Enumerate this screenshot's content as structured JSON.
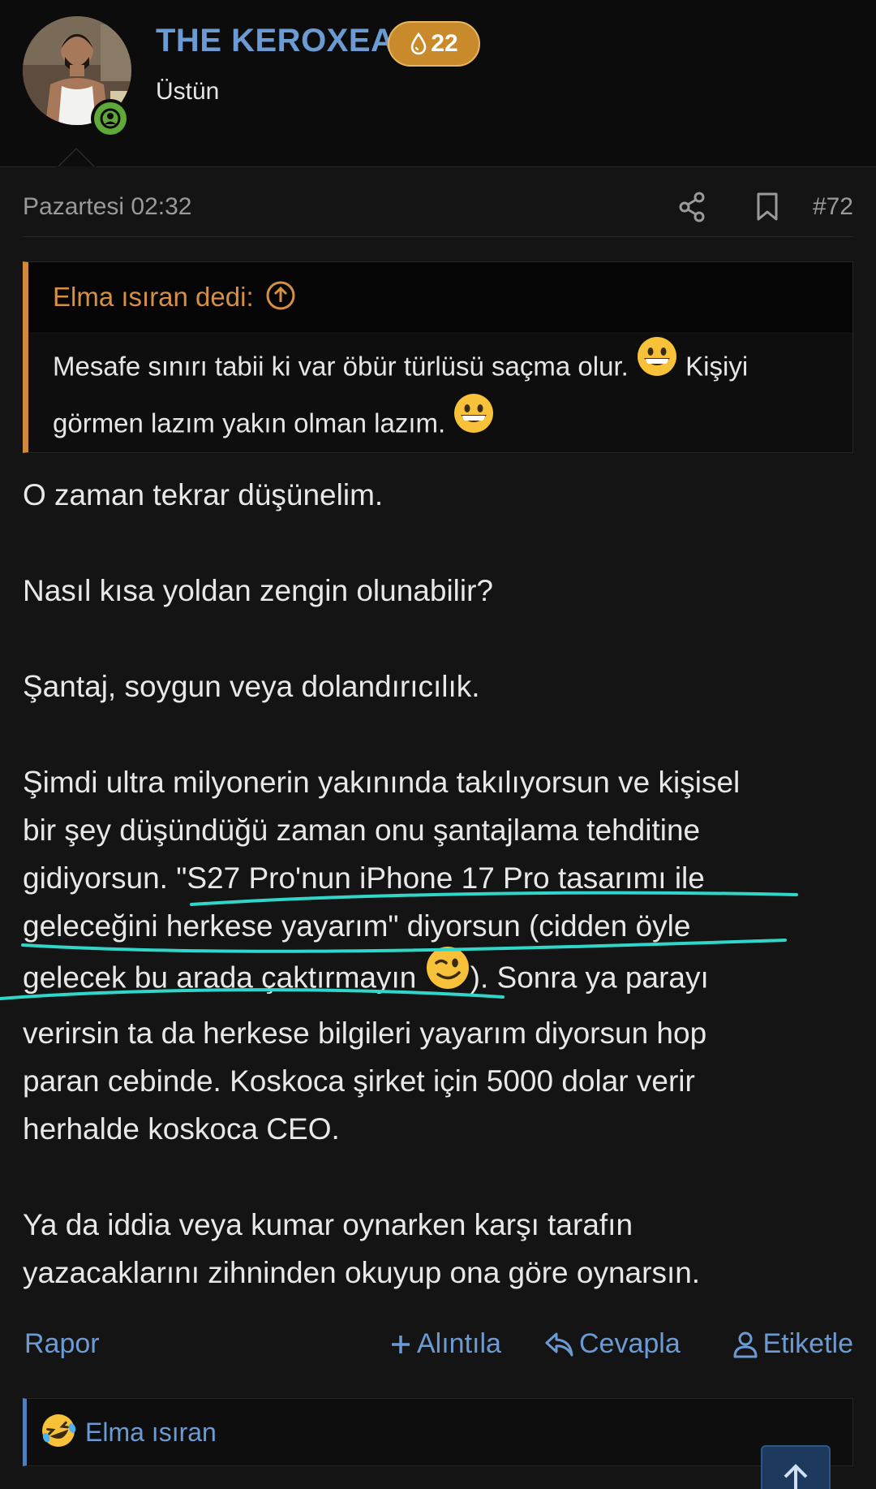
{
  "user": {
    "name": "THE KEROXEA",
    "reaction_score": "22",
    "title": "Üstün",
    "status": "online"
  },
  "post": {
    "date": "Pazartesi 02:32",
    "number": "#72"
  },
  "quote": {
    "author": "Elma ısıran dedi:",
    "text_1": "Mesafe sınırı tabii ki var öbür türlüsü saçma olur.",
    "text_2": "Kişiyi",
    "text_3": "görmen lazım yakın olman lazım.",
    "emoji": "grinning-face"
  },
  "body": {
    "p1": "O zaman tekrar düşünelim.",
    "p2": "Nasıl kısa yoldan zengin olunabilir?",
    "p3": "Şantaj, soygun veya dolandırıcılık.",
    "p4_line1": "Şimdi ultra milyonerin yakınında takılıyorsun ve kişisel",
    "p4_line2": "bir şey düşündüğü zaman onu şantajlama tehditine",
    "p4_line3a": "gidiyorsun. ",
    "p4_line3b": "\"S27 Pro'nun iPhone 17 Pro tasarımı ile",
    "p4_line4a": "geleceğini herkese yayarım\"",
    "p4_line4b": " diyorsun (cidden öyle",
    "p4_line5a": "gelecek bu arada çaktırmayın ",
    "p4_line5b": "). Sonra ya parayı",
    "p4_line6": "verirsin ta da herkese bilgileri yayarım diyorsun hop",
    "p4_line7": "paran cebinde. Koskoca şirket için 5000 dolar verir",
    "p4_line8": "herhalde koskoca CEO.",
    "p5_line1": "Ya da iddia veya kumar oynarken karşı tarafın",
    "p5_line2": "yazacaklarını zihninden okuyup ona göre oynarsın.",
    "wink_emoji": "winking-face"
  },
  "actions": {
    "report": "Rapor",
    "quote": "Alıntıla",
    "reply": "Cevapla",
    "tag": "Etiketle"
  },
  "reactions": {
    "reactor": "Elma ısıran",
    "emoji": "rolling-on-floor-laughing"
  },
  "colors": {
    "link": "#6c9bd4",
    "quote_accent": "#d08a3a",
    "badge": "#c98a2c",
    "online": "#5fa83a",
    "scribble": "#2fd6c9"
  }
}
